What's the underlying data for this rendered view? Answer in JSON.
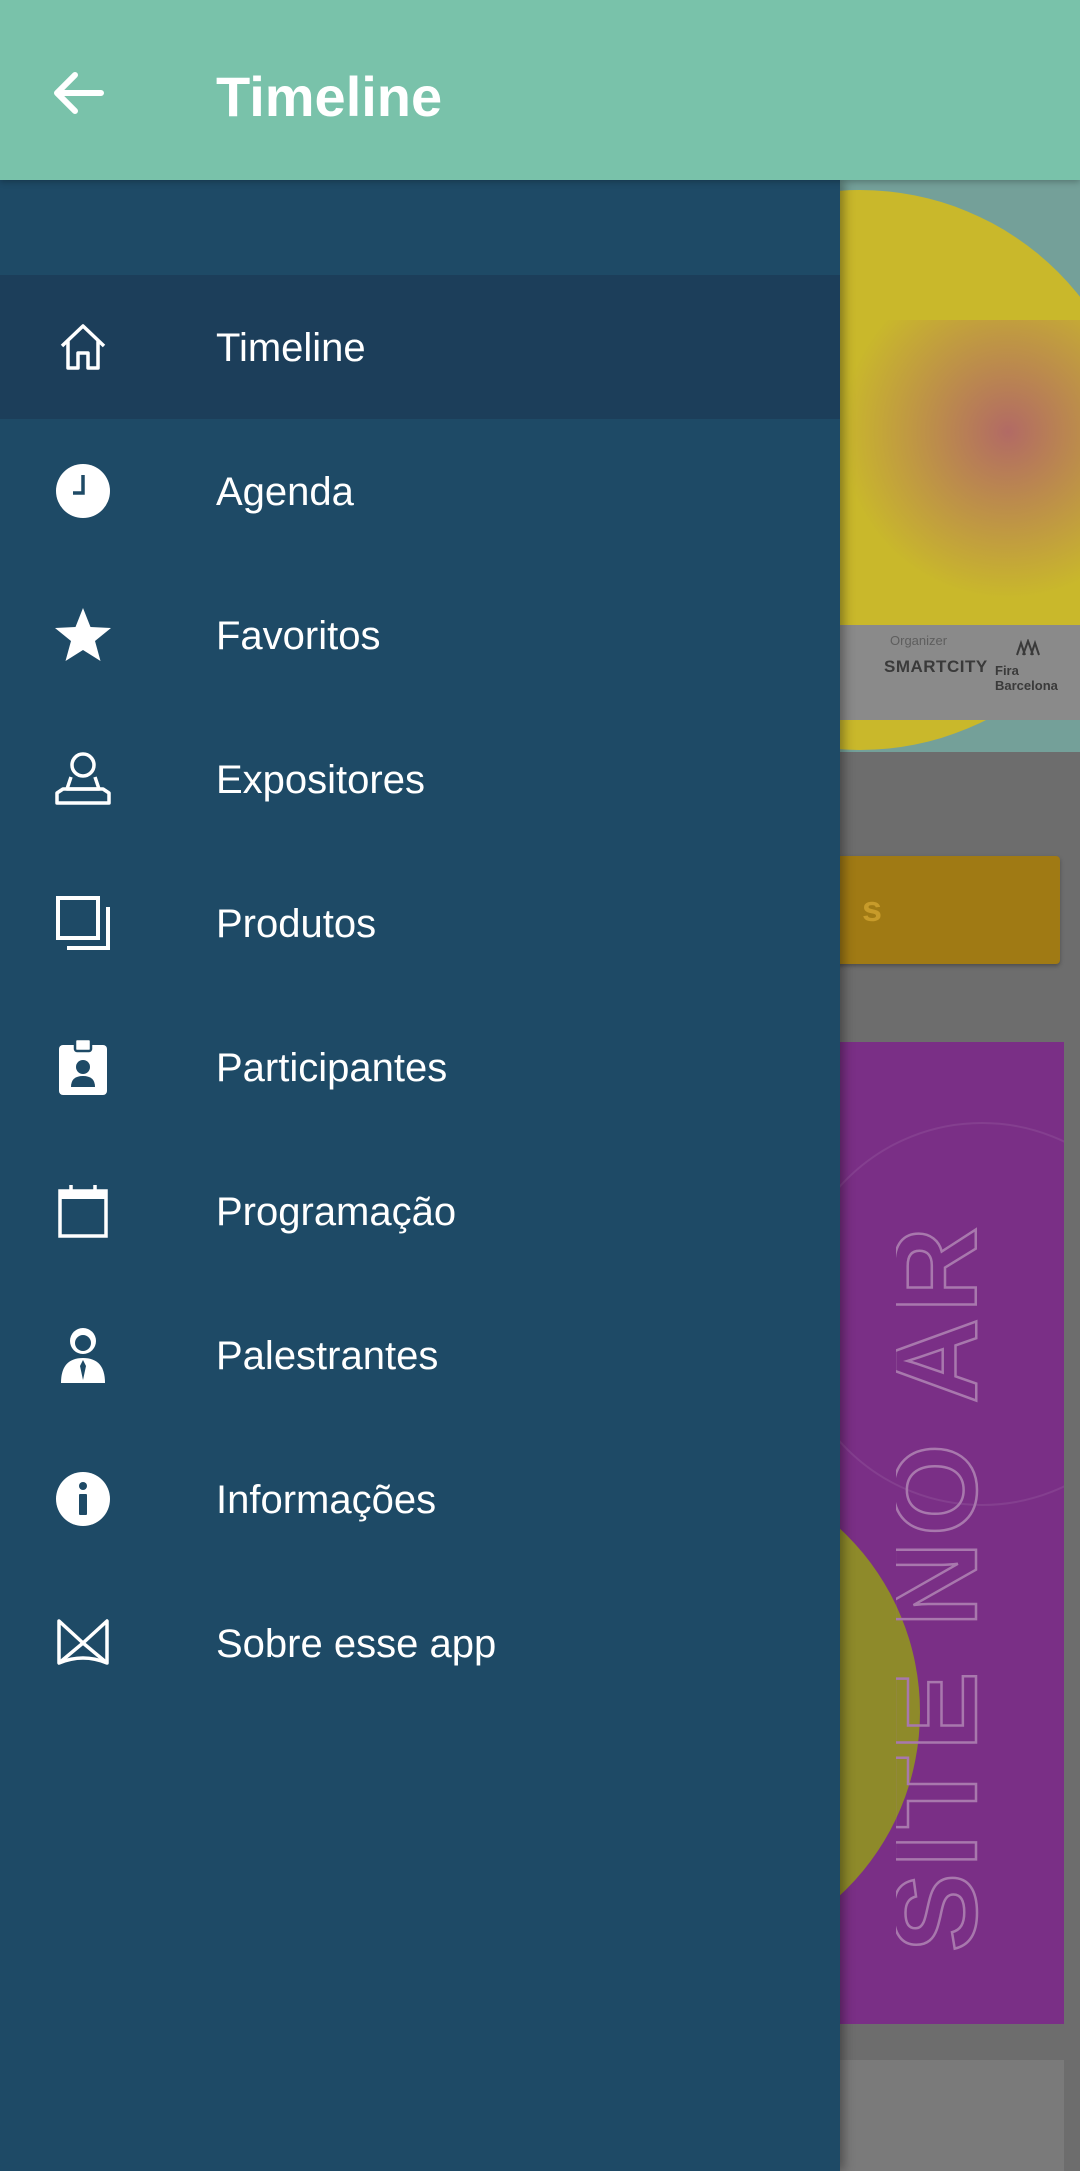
{
  "app_bar": {
    "title": "Timeline",
    "back_icon": "arrow-left-icon",
    "color": "#79c2aa"
  },
  "drawer": {
    "color": "#1e4a66",
    "active_color": "#1c3e5a",
    "items": [
      {
        "label": "Timeline",
        "icon": "home-icon",
        "active": true
      },
      {
        "label": "Agenda",
        "icon": "clock-icon",
        "active": false
      },
      {
        "label": "Favoritos",
        "icon": "star-icon",
        "active": false
      },
      {
        "label": "Expositores",
        "icon": "exhibitor-icon",
        "active": false
      },
      {
        "label": "Produtos",
        "icon": "products-icon",
        "active": false
      },
      {
        "label": "Participantes",
        "icon": "badge-icon",
        "active": false
      },
      {
        "label": "Programação",
        "icon": "calendar-icon",
        "active": false
      },
      {
        "label": "Palestrantes",
        "icon": "speaker-icon",
        "active": false
      },
      {
        "label": "Informações",
        "icon": "info-icon",
        "active": false
      },
      {
        "label": "Sobre esse app",
        "icon": "about-app-icon",
        "active": false
      }
    ]
  },
  "background": {
    "banner_logos": {
      "organizer_label": "Organizer",
      "smartcity": "SMARTCITY",
      "fira": "Fira Barcelona"
    },
    "cta_partial_text": "s",
    "card_text": "SITE NO AR"
  }
}
